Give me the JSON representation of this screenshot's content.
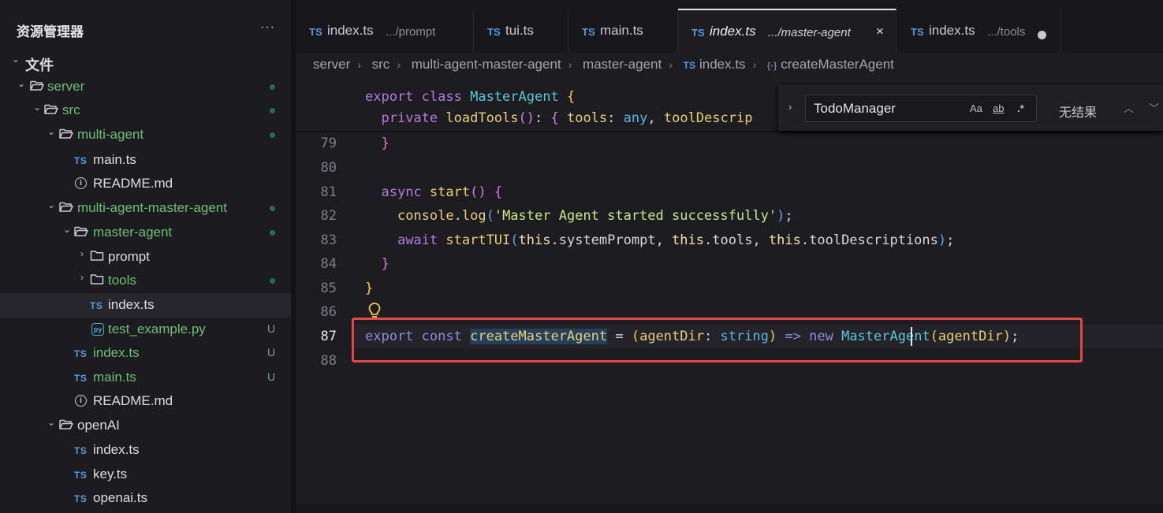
{
  "sidebar": {
    "title": "资源管理器",
    "more": "···",
    "section": "文件",
    "tree": [
      {
        "label": "server",
        "kind": "folder",
        "status": "dot"
      },
      {
        "label": "src",
        "kind": "folder",
        "status": "dot"
      },
      {
        "label": "multi-agent",
        "kind": "folder",
        "status": "dot"
      },
      {
        "label": "main.ts",
        "kind": "ts",
        "status": ""
      },
      {
        "label": "README.md",
        "kind": "info",
        "status": ""
      },
      {
        "label": "multi-agent-master-agent",
        "kind": "folder",
        "status": "dot"
      },
      {
        "label": "master-agent",
        "kind": "folder",
        "status": "dot"
      },
      {
        "label": "prompt",
        "kind": "folder-closed",
        "status": ""
      },
      {
        "label": "tools",
        "kind": "folder-closed",
        "status": "dot"
      },
      {
        "label": "index.ts",
        "kind": "ts",
        "status": ""
      },
      {
        "label": "test_example.py",
        "kind": "py",
        "status": "U"
      },
      {
        "label": "index.ts",
        "kind": "ts",
        "status": "U"
      },
      {
        "label": "main.ts",
        "kind": "ts",
        "status": "U"
      },
      {
        "label": "README.md",
        "kind": "info",
        "status": ""
      },
      {
        "label": "openAI",
        "kind": "folder",
        "status": ""
      },
      {
        "label": "index.ts",
        "kind": "ts",
        "status": ""
      },
      {
        "label": "key.ts",
        "kind": "ts",
        "status": ""
      },
      {
        "label": "openai.ts",
        "kind": "ts",
        "status": ""
      }
    ]
  },
  "tabs": [
    {
      "badge": "TS",
      "name": "index.ts",
      "desc": ".../prompt"
    },
    {
      "badge": "TS",
      "name": "tui.ts",
      "desc": ""
    },
    {
      "badge": "TS",
      "name": "main.ts",
      "desc": ""
    },
    {
      "badge": "TS",
      "name": "index.ts",
      "desc": ".../master-agent",
      "close": "×"
    },
    {
      "badge": "TS",
      "name": "index.ts",
      "desc": ".../tools"
    }
  ],
  "breadcrumb": [
    "server",
    "src",
    "multi-agent-master-agent",
    "master-agent",
    "index.ts",
    "createMasterAgent"
  ],
  "breadcrumb_ts": "TS",
  "breadcrumb_sym": "{◦}",
  "find": {
    "value": "TodoManager",
    "opt_case": "Aa",
    "opt_word": "ab",
    "opt_regex": ".*",
    "result": "无结果",
    "expand": "›",
    "prev": "︿",
    "next": "﹀"
  },
  "lines": {
    "79": "79",
    "80": "80",
    "81": "81",
    "82": "82",
    "83": "83",
    "84": "84",
    "85": "85",
    "86": "86",
    "87": "87",
    "88": "88"
  },
  "code": {
    "sticky1_a": "export",
    "sticky1_b": "class",
    "sticky1_c": "MasterAgent",
    "sticky2_a": "private",
    "sticky2_b": "loadTools",
    "sticky2_c": "tools",
    "sticky2_d": "any",
    "sticky2_e": "toolDescrip",
    "l81_a": "async",
    "l81_b": "start",
    "l82_a": "console",
    "l82_b": "log",
    "l82_c": "'Master Agent started successfully'",
    "l83_a": "await",
    "l83_b": "startTUI",
    "l83_c": "this",
    "l83_d": "systemPrompt",
    "l83_e": "this",
    "l83_f": "tools",
    "l83_g": "this",
    "l83_h": "toolDescriptions",
    "l87_a": "export",
    "l87_b": "const",
    "l87_c": "createMasterAgent",
    "l87_d": "agentDir",
    "l87_e": "string",
    "l87_f": "=>",
    "l87_g": "new",
    "l87_h": "MasterAgent",
    "l87_i": "agentDir"
  }
}
